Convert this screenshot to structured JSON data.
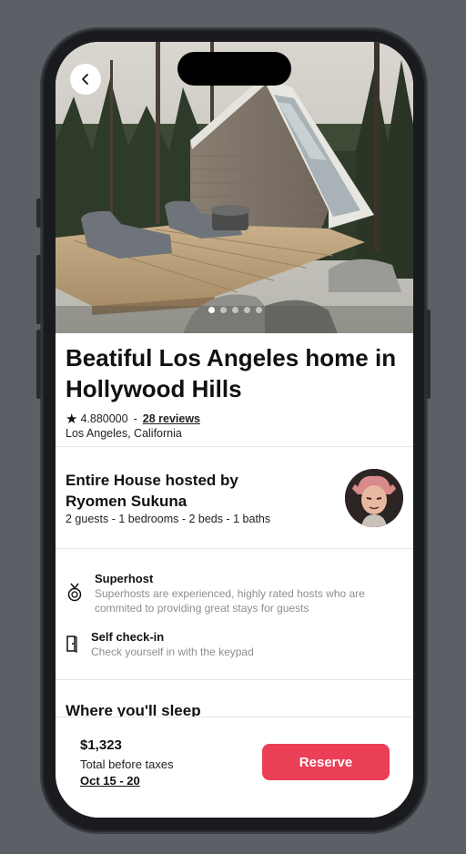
{
  "listing": {
    "title": "Beatiful Los Angeles home in Hollywood Hills",
    "rating": "4.880000",
    "separator": "-",
    "reviews": "28 reviews",
    "location": "Los Angeles, California",
    "photo_count": 5,
    "active_photo_index": 0
  },
  "host": {
    "title": "Entire House hosted by Ryomen Sukuna",
    "stats": "2 guests - 1 bedrooms - 2 beds - 1 baths"
  },
  "features": [
    {
      "icon": "medal-icon",
      "title": "Superhost",
      "description": "Superhosts are experienced, highly rated hosts who are commited to providing great stays for guests"
    },
    {
      "icon": "door-icon",
      "title": "Self check-in",
      "description": "Check yourself in with the keypad"
    }
  ],
  "sleep": {
    "title": "Where you'll sleep"
  },
  "footer": {
    "price": "$1,323",
    "price_note": "Total before taxes",
    "dates": "Oct 15 - 20",
    "reserve_label": "Reserve"
  },
  "colors": {
    "accent": "#eb3f58"
  }
}
